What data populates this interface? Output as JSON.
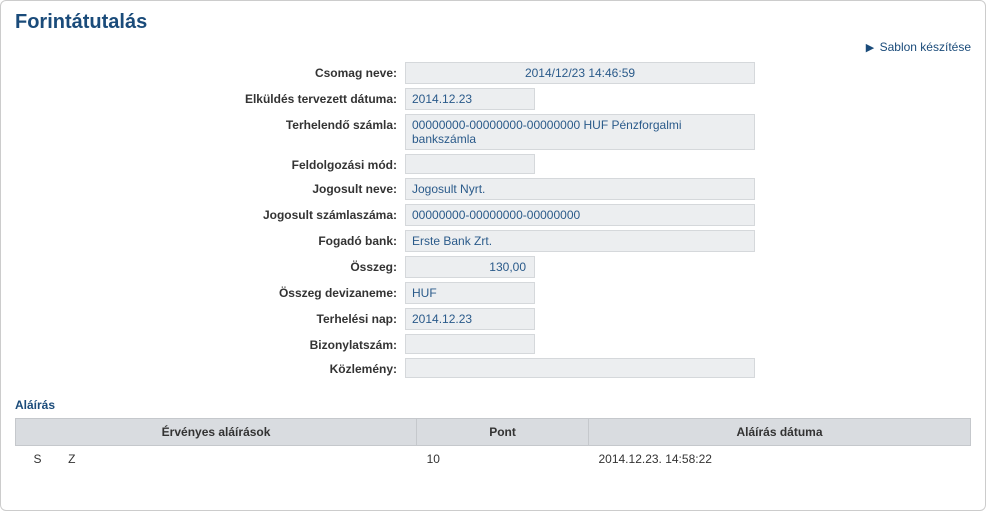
{
  "title": "Forintátutalás",
  "action_link": "Sablon készítése",
  "fields": {
    "csomag_neve_label": "Csomag neve:",
    "csomag_neve_value": "2014/12/23 14:46:59",
    "elkuldes_label": "Elküldés tervezett dátuma:",
    "elkuldes_value": "2014.12.23",
    "terhelendo_label": "Terhelendő számla:",
    "terhelendo_value": "00000000-00000000-00000000  HUF Pénzforgalmi bankszámla",
    "feldolgozas_label": "Feldolgozási mód:",
    "feldolgozas_value": "",
    "jogosult_neve_label": "Jogosult neve:",
    "jogosult_neve_value": "Jogosult Nyrt.",
    "jogosult_szam_label": "Jogosult számlaszáma:",
    "jogosult_szam_value": "00000000-00000000-00000000",
    "fogado_bank_label": "Fogadó bank:",
    "fogado_bank_value": "Erste Bank Zrt.",
    "osszeg_label": "Összeg:",
    "osszeg_value": "130,00",
    "devizanem_label": "Összeg devizaneme:",
    "devizanem_value": "HUF",
    "terhelesi_label": "Terhelési nap:",
    "terhelesi_value": "2014.12.23",
    "bizonylat_label": "Bizonylatszám:",
    "bizonylat_value": "",
    "kozlemeny_label": "Közlemény:",
    "kozlemeny_value": ""
  },
  "signature_section": "Aláírás",
  "sig_headers": {
    "col1": "Érvényes aláírások",
    "col2": "Pont",
    "col3": "Aláírás dátuma"
  },
  "sig_row": {
    "name": "S        Z",
    "pont": "10",
    "datum": "2014.12.23. 14:58:22"
  }
}
